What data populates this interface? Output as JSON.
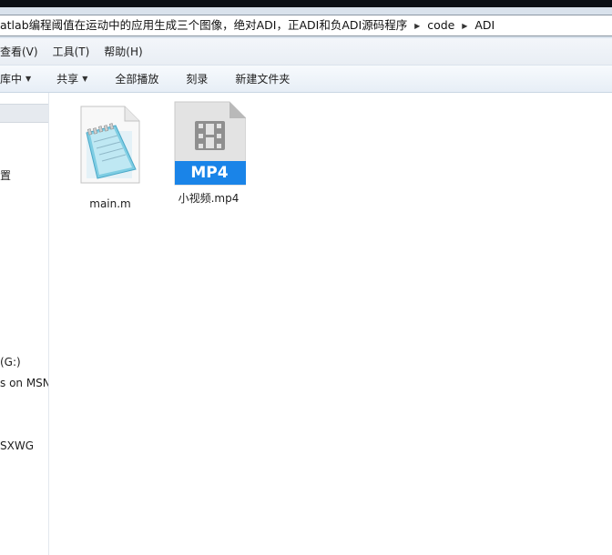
{
  "address": {
    "crumbs": [
      "atlab编程阈值在运动中的应用生成三个图像，绝对ADI，正ADI和负ADI源码程序",
      "code",
      "ADI"
    ]
  },
  "menu": {
    "items": [
      "查看(V)",
      "工具(T)",
      "帮助(H)"
    ]
  },
  "toolbar": {
    "include_library": "库中",
    "share": "共享",
    "play_all": "全部播放",
    "burn": "刻录",
    "new_folder": "新建文件夹"
  },
  "nav": {
    "items": [
      "置",
      "(G:)",
      "s on MSN",
      "SXWG"
    ]
  },
  "files": [
    {
      "name": "main.m",
      "icon": "notepad-file-icon"
    },
    {
      "name": "小视频.mp4",
      "icon": "mp4-file-icon",
      "badge": "MP4"
    }
  ],
  "colors": {
    "mp4_badge": "#1a84e8",
    "toolbar_bg": "#e7eef6",
    "nav_selected": "#e6eaef"
  }
}
